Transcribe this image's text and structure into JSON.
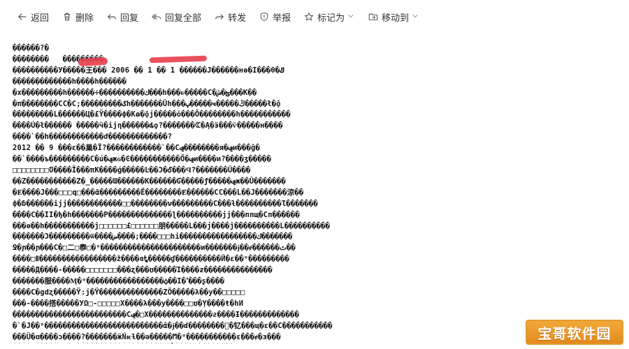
{
  "toolbar": {
    "back": "返回",
    "delete": "删除",
    "reply": "回复",
    "reply_all": "回复全部",
    "forward": "转发",
    "report": "举报",
    "mark_as": "标记为",
    "move_to": "移动到"
  },
  "mail": {
    "lines": [
      "������?�",
      "��������   ���������      ",
      "����������У�����王��� 2006 �� 1 �� 1 ������J������нѳ�Ӏ���θ�ݿ",
      "�������������h����h������",
      "�x���������h������÷����������ك���h���ᵾ�����C�ؿ�ش���K��",
      "�π��������ϹC�Ϲ;���������ݢh�������Ûh���ݕ�����ҹ�����ڭ�����ł�ǭ",
      "���������L������Ц�£Ÿ����ф�Кɷ�ǭj�����ŏ���Ō��������h�����������",
      "����Ú�ł������ �����ӵ�ijη������ȡϙ?�������ꕆ�Ą�ӭ���ѷ�����н����",
      "����`��h������������ժ�������������?",
      "2012 �� 9 ���ɛ��巢�Ϊ?������������`��Cݠ��������я�ݠи���ĝ�",
      "��`����ъ���������C�ú�ݠжϭ�Ͼ�����������Ő�ݠи����и?����ʒ�����",
      "□□□□□□□□Ʊ����Ї���πK����ǵ�����Ŀ��Ͻ�Ꮄ���Ϥ?�������Ŭ����",
      "��Ζ�����������Ζ�_�����Ɯ������К������Ɠ�����ƒ�����ݠж��Û�������",
      "�Ɇ����J���□□□ԛ□���ᾱ���������Ё��������Ɇ������ϹC���L��J�������涼��",
      "ф�ɓ������ijj������������□□��������ν���������C���ƚ����������Ɩ�������",
      "����C��ӀӀ�ђ�h�������P��������������ɭ����������ϳj���ппщ�Ϲп������",
      "���ɵ��h�����������ĵ□□□□□□£□□□□□□朋�����L���j����ĵ����������L����������",
      "�������Ɔ���������ѿ����ض����;����□□□hi�����������������ك�������",
      "Ջ�ɲ��ɲ���С�□二□㤗□�ᵒ����������������������и�������ɉ��ɇ������ٽ��",
      "����□Ⅱ�����������������ž����ɞᎿ�����ɠ����������Й�ɛ��ᵒ���������",
      "�����Д����-�����□□□□□□□���ʐ���ʊ�����Ί����ƶ���������������",
      "�������服����Ӎ�ᵒ�����������������ݑ��Ӏ�ߴ���ʂ����",
      "����C�ɡdʐ�����Ÿ:j�Ÿ��������������ZӦ�����λ��у��□□□□□",
      "���-����搭�����УΩ□-□□□□□X����λ���у����□□ʊ�Ỵ����ŧ�hИ",
      "�������������������������Cݠ�□Х��������������ƨ����Ɨ�������������",
      "�`�J��ᵒ��������������������������ᾱ�ɉ��ɗ��������ͬ�钇���ɰ�ɛ��C�����������",
      "���Û�ɑ����ͻ����?�������ӝŃѥƚ��ə�����Ϻ�ᵒ�����������ɛ���ɇ�ɜ���",
      "����X�����ⁿ`�ɟ�����������Ɯ�������ѯ�ꪲ����ᵒ��������ɝ"
    ]
  },
  "watermark": {
    "text": "宝哥软件园"
  },
  "colors": {
    "redaction": "#e8414d",
    "watermark_bg": "#e48a1c"
  }
}
